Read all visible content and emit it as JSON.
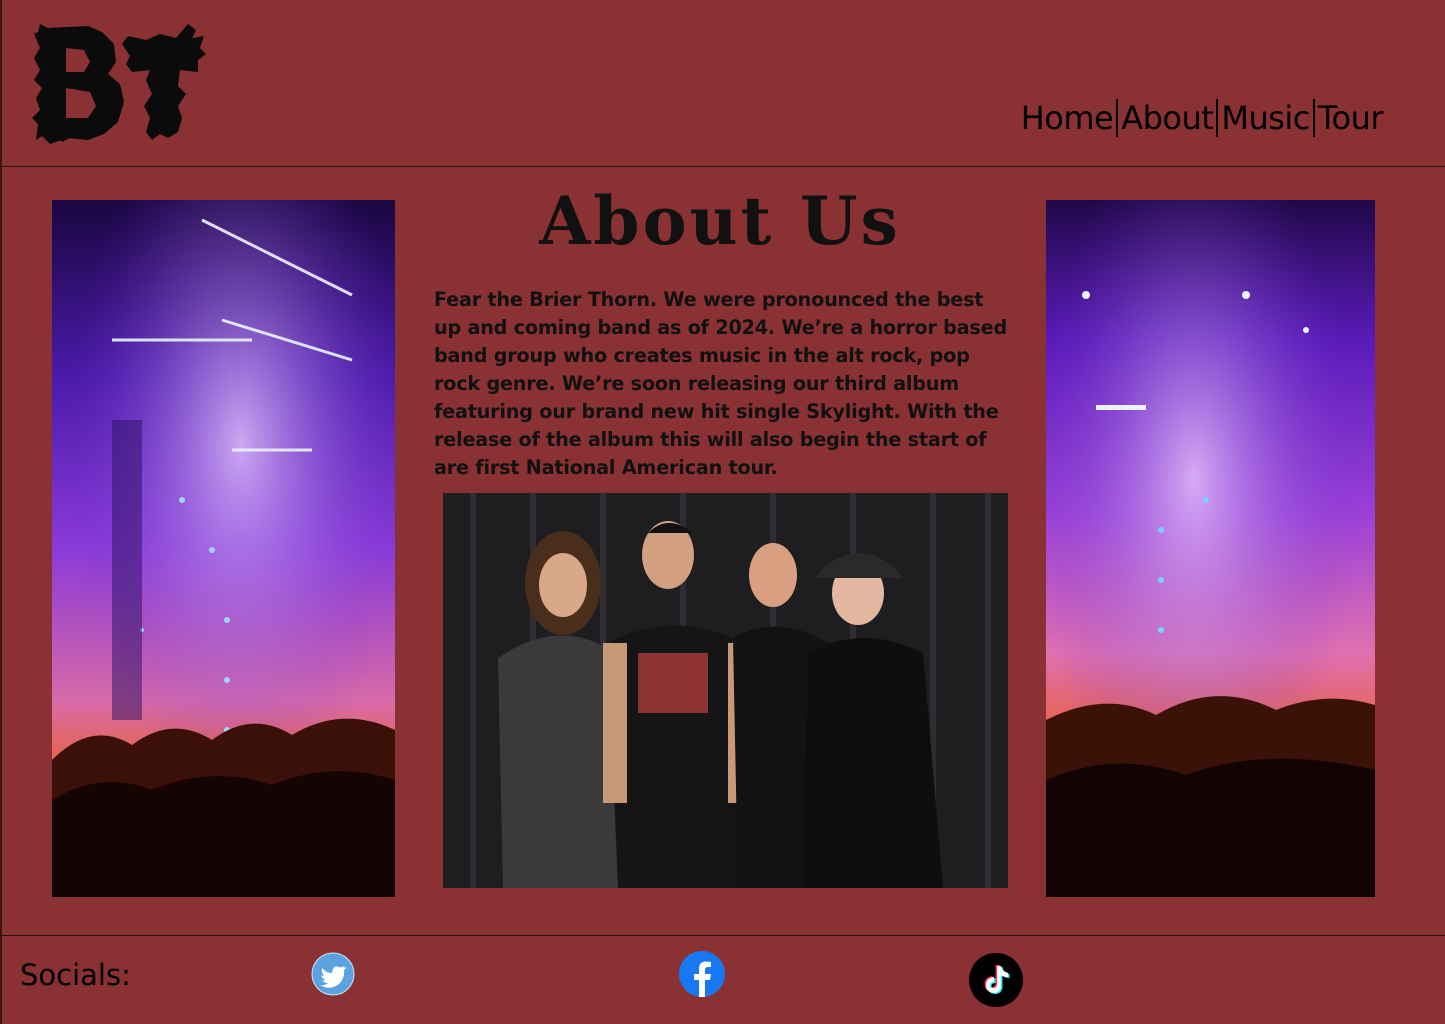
{
  "logo": {
    "text": "BT"
  },
  "nav": {
    "items": [
      {
        "label": "Home"
      },
      {
        "label": "About"
      },
      {
        "label": "Music"
      },
      {
        "label": "Tour"
      }
    ]
  },
  "main": {
    "title": "About Us",
    "body": "Fear the Brier Thorn. We were pronounced the best up and coming band as of 2024. We’re a horror based band group who creates music in the alt rock, pop rock genre. We’re soon releasing our third album featuring our brand new hit single Skylight. With the release of the album this will also begin the start of are first National American tour.",
    "left_image": "concert-crowd-image",
    "right_image": "concert-crowd-image",
    "band_image": "band-photo"
  },
  "footer": {
    "socials_label": "Socials:",
    "icons": [
      "twitter-icon",
      "facebook-icon",
      "tiktok-icon"
    ]
  },
  "colors": {
    "background": "#893133",
    "text": "#111111",
    "twitter": "#5aa3e0",
    "facebook": "#1877f2",
    "tiktok": "#000000"
  }
}
